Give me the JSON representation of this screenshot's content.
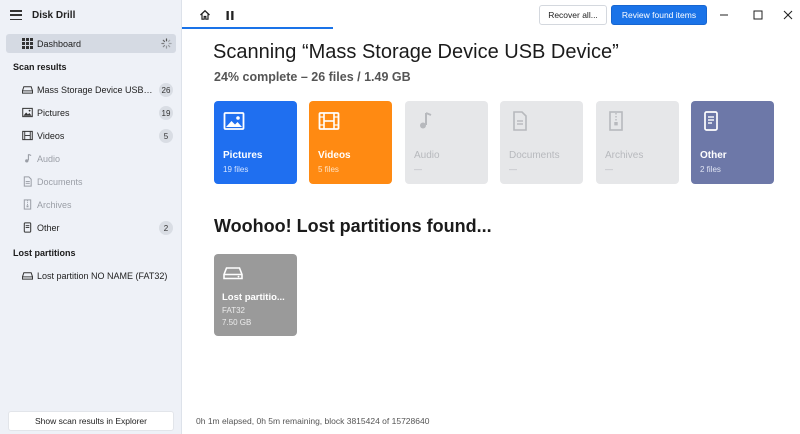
{
  "app": {
    "title": "Disk Drill"
  },
  "sidebar": {
    "dashboard_label": "Dashboard",
    "scan_results_heading": "Scan results",
    "items": [
      {
        "label": "Mass Storage Device USB D...",
        "count": "26",
        "icon": "drive-icon",
        "enabled": true
      },
      {
        "label": "Pictures",
        "count": "19",
        "icon": "image-icon",
        "enabled": true
      },
      {
        "label": "Videos",
        "count": "5",
        "icon": "film-icon",
        "enabled": true
      },
      {
        "label": "Audio",
        "count": "",
        "icon": "music-note-icon",
        "enabled": false
      },
      {
        "label": "Documents",
        "count": "",
        "icon": "document-icon",
        "enabled": false
      },
      {
        "label": "Archives",
        "count": "",
        "icon": "archive-icon",
        "enabled": false
      },
      {
        "label": "Other",
        "count": "2",
        "icon": "file-icon",
        "enabled": true
      }
    ],
    "lost_partitions_heading": "Lost partitions",
    "lost_partitions": [
      {
        "label": "Lost partition NO NAME (FAT32)",
        "icon": "drive-icon"
      }
    ],
    "show_explorer_label": "Show scan results in Explorer"
  },
  "toolbar": {
    "recover_label": "Recover all...",
    "review_label": "Review found items"
  },
  "main": {
    "title": "Scanning “Mass Storage Device USB Device”",
    "progress": "24% complete – 26 files / 1.49 GB",
    "progress_percent": 24,
    "tiles": [
      {
        "name": "Pictures",
        "sub": "19 files",
        "icon": "image-icon",
        "color": "#1f6ff0"
      },
      {
        "name": "Videos",
        "sub": "5 files",
        "icon": "film-icon",
        "color": "#ff8a12"
      },
      {
        "name": "Audio",
        "sub": "—",
        "icon": "music-note-icon",
        "color": "#e6e7e9"
      },
      {
        "name": "Documents",
        "sub": "—",
        "icon": "document-icon",
        "color": "#e6e7e9"
      },
      {
        "name": "Archives",
        "sub": "—",
        "icon": "archive-icon",
        "color": "#e6e7e9"
      },
      {
        "name": "Other",
        "sub": "2 files",
        "icon": "file-icon",
        "color": "#6d78a8"
      }
    ],
    "partitions_title": "Woohoo! Lost partitions found...",
    "partition": {
      "name": "Lost partitio...",
      "fs": "FAT32",
      "size": "7.50 GB"
    }
  },
  "status": "0h 1m elapsed, 0h 5m remaining, block 3815424 of 15728640",
  "colors": {
    "accent": "#1a73e8",
    "sidebar_bg": "#eef1f7"
  }
}
